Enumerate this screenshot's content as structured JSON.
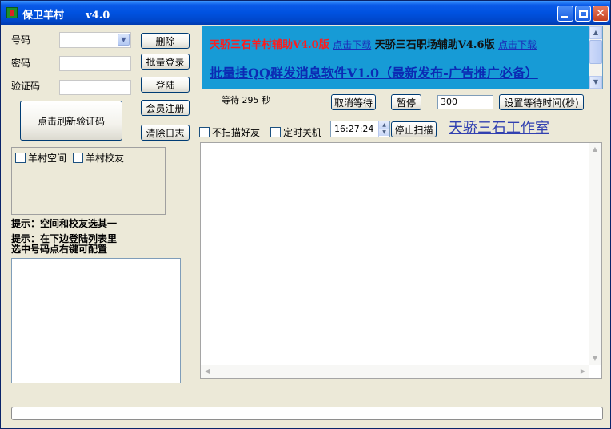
{
  "window": {
    "title": "保卫羊村      v4.0",
    "minimize_glyph": "",
    "maximize_glyph": "",
    "close_glyph": "✕"
  },
  "login": {
    "account_label": "号码",
    "account_value": "",
    "password_label": "密码",
    "password_value": "",
    "captcha_label": "验证码",
    "captcha_value": "",
    "refresh_captcha_button": "点击刷新验证码"
  },
  "buttons": {
    "delete": "删除",
    "batch_login": "批量登录",
    "login": "登陆",
    "register": "会员注册",
    "clear_log": "清除日志",
    "cancel_wait": "取消等待",
    "pause": "暂停",
    "set_wait_time": "设置等待时间(秒)",
    "stop_scan": "停止扫描"
  },
  "options": {
    "village_space": "羊村空间",
    "village_school": "羊村校友",
    "no_scan_friends": "不扫描好友",
    "timed_shutdown": "定时关机"
  },
  "hints": {
    "line1": "提示：空间和校友选其一",
    "line2": "提示：在下边登陆列表里",
    "line3": "选中号码点右键可配置"
  },
  "ad": {
    "product1": "天骄三石羊村辅助V4.0版",
    "download1": "点击下载",
    "product2": "天骄三石职场辅助V4.6版",
    "download2": "点击下载",
    "headline": "批量挂QQ群发消息软件V1.0（最新发布-广告推广必备）"
  },
  "wait": {
    "status": "等待 295 秒",
    "seconds_input": "300"
  },
  "timer": {
    "time": "16:27:24"
  },
  "studio_link": "天骄三石工作室",
  "colors": {
    "title_bar": "#0052e0",
    "ad_bg": "#179bd6",
    "ad_red": "#ff1c1c",
    "link_blue": "#1a2db8"
  }
}
